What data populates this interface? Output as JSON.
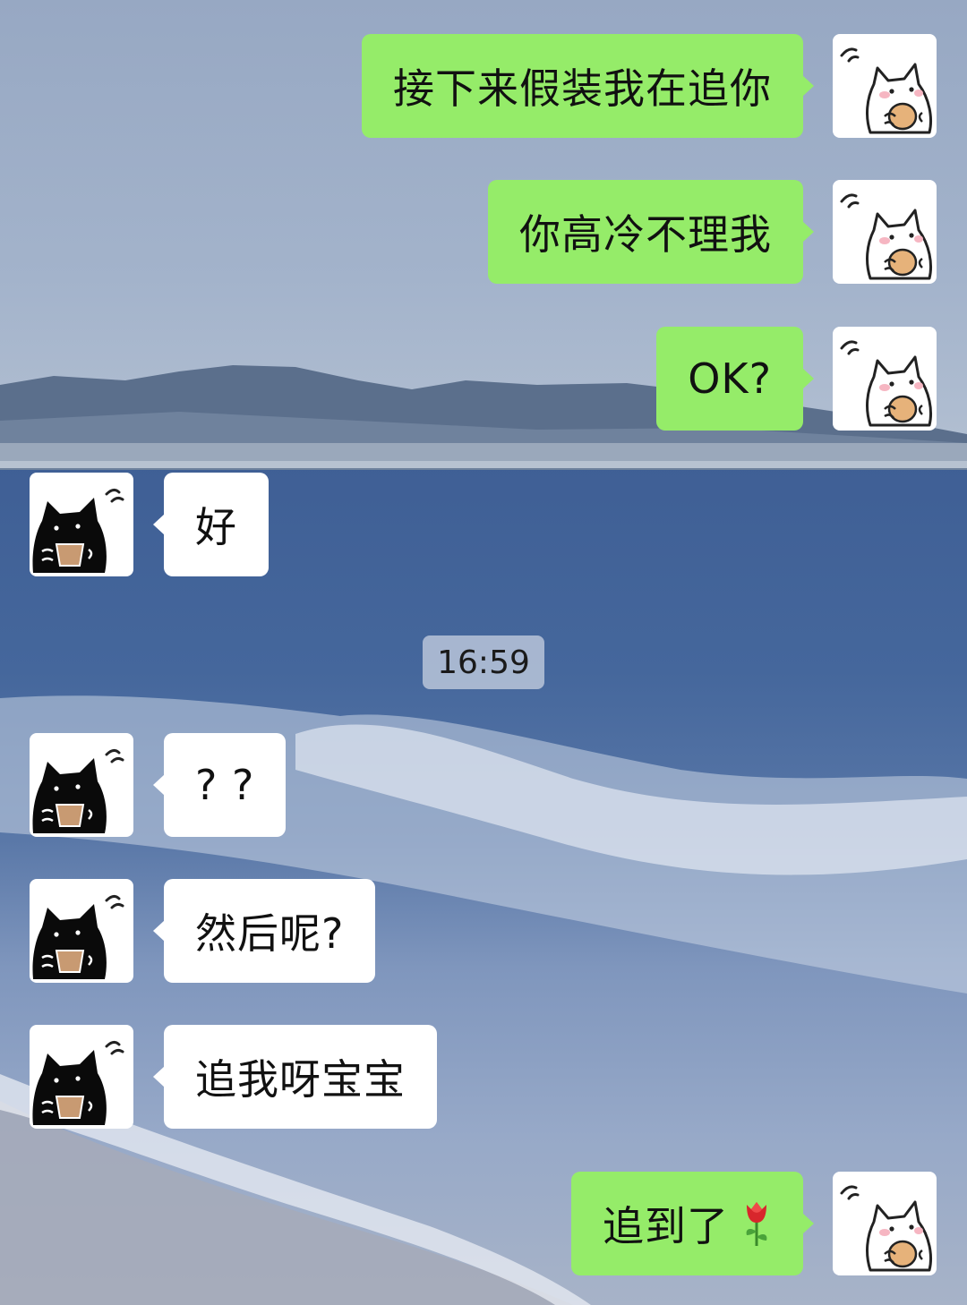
{
  "messages": [
    {
      "side": "me",
      "text": "接下来假装我在追你"
    },
    {
      "side": "me",
      "text": "你高冷不理我"
    },
    {
      "side": "me",
      "text": "OK?"
    },
    {
      "side": "them",
      "text": "好"
    },
    {
      "side": "them",
      "text": "? ?"
    },
    {
      "side": "them",
      "text": "然后呢?"
    },
    {
      "side": "them",
      "text": "追我呀宝宝"
    },
    {
      "side": "me",
      "text": "追到了",
      "emoji": "rose-icon"
    }
  ],
  "timestamp": "16:59",
  "colors": {
    "my_bubble": "#95ec69",
    "their_bubble": "#ffffff",
    "text": "#111111"
  },
  "avatars": {
    "me": "white-cat-avatar",
    "them": "black-cat-avatar"
  }
}
